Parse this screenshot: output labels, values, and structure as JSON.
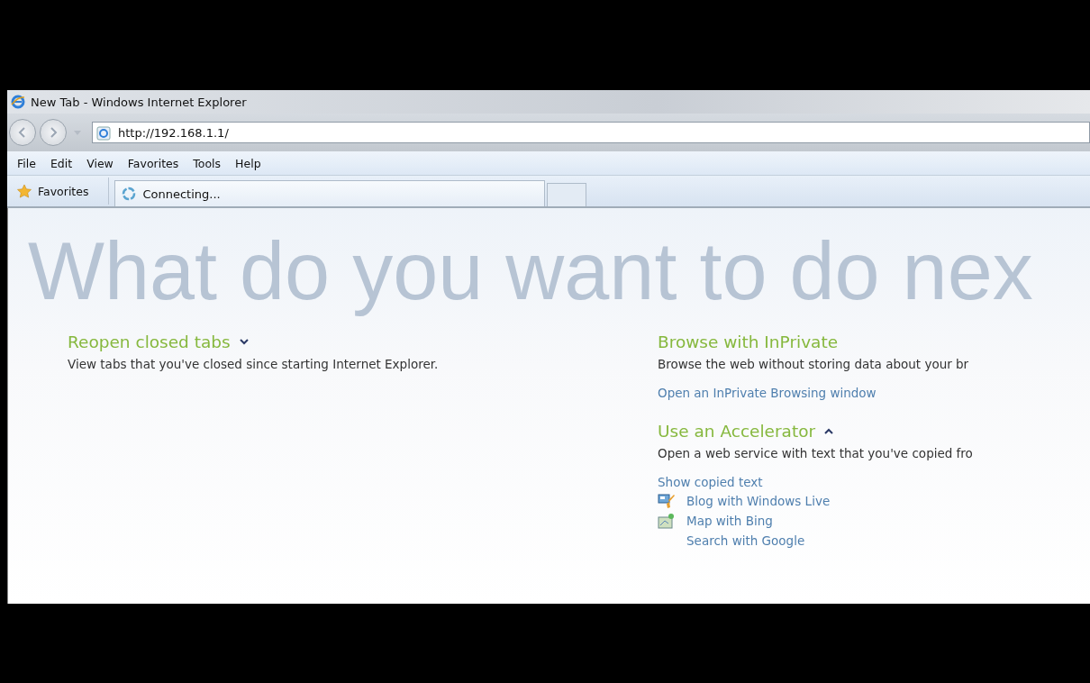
{
  "window": {
    "title": "New Tab - Windows Internet Explorer"
  },
  "address_bar": {
    "value": "http://192.168.1.1/"
  },
  "menu": [
    "File",
    "Edit",
    "View",
    "Favorites",
    "Tools",
    "Help"
  ],
  "favorites_button": {
    "label": "Favorites"
  },
  "tabs": [
    {
      "label": "Connecting...",
      "selected": true
    }
  ],
  "page": {
    "heading": "What do you want to do nex",
    "left_sections": [
      {
        "title": "Reopen closed tabs",
        "expanded": false,
        "description": "View tabs that you've closed since starting Internet Explorer."
      }
    ],
    "right_sections": [
      {
        "title": "Browse with InPrivate",
        "description": "Browse the web without storing data about your br",
        "links": [
          "Open an InPrivate Browsing window"
        ]
      },
      {
        "title": "Use an Accelerator",
        "expanded": true,
        "description": "Open a web service with text that you've copied fro",
        "links": [
          "Show copied text"
        ],
        "accelerators": [
          {
            "kind": "blog",
            "label": "Blog with Windows Live"
          },
          {
            "kind": "map",
            "label": "Map with Bing"
          },
          {
            "kind": "plain",
            "label": "Search with Google"
          }
        ]
      }
    ]
  }
}
